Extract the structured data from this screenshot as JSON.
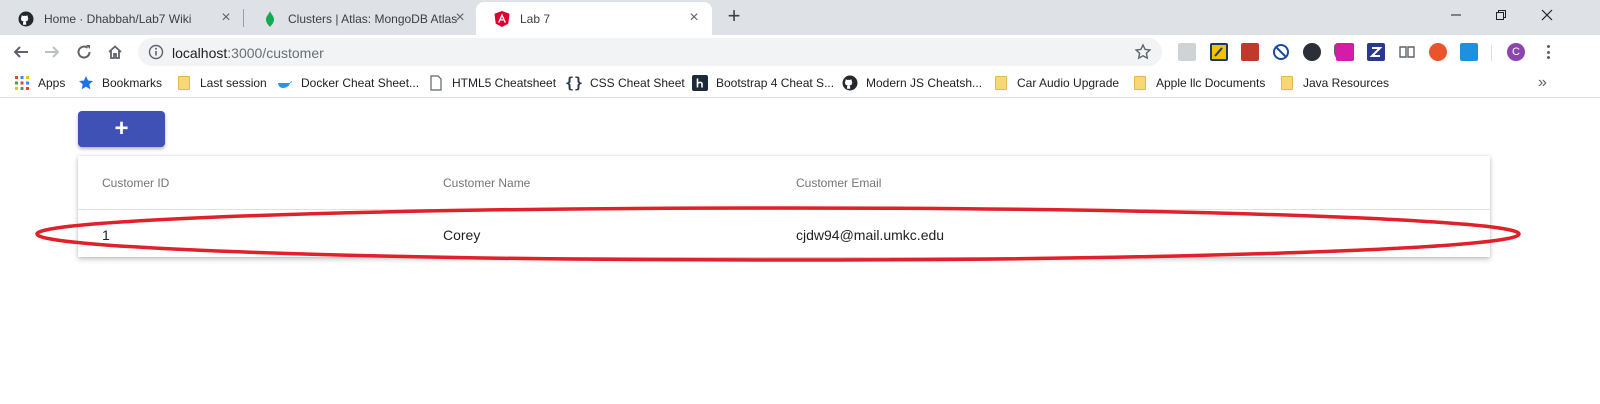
{
  "browser": {
    "tabs": [
      {
        "title": "Home · Dhabbah/Lab7 Wiki",
        "icon": "github-icon"
      },
      {
        "title": "Clusters | Atlas: MongoDB Atlas",
        "icon": "mongodb-leaf-icon"
      },
      {
        "title": "Lab 7",
        "icon": "angular-icon",
        "active": true
      }
    ],
    "url_host": "localhost",
    "url_path": ":3000/customer",
    "profile_initial": "C",
    "bookmarks": [
      {
        "label": "Apps",
        "icon": "apps-grid-icon"
      },
      {
        "label": "Bookmarks",
        "icon": "star-icon"
      },
      {
        "label": "Last session",
        "icon": "folder-icon"
      },
      {
        "label": "Docker Cheat Sheet...",
        "icon": "docker-icon"
      },
      {
        "label": "HTML5 Cheatsheet",
        "icon": "page-icon"
      },
      {
        "label": "CSS Cheat Sheet",
        "icon": "braces-icon"
      },
      {
        "label": "Bootstrap 4 Cheat S...",
        "icon": "h-logo-icon"
      },
      {
        "label": "Modern JS Cheatsh...",
        "icon": "github-icon"
      },
      {
        "label": "Car Audio Upgrade",
        "icon": "folder-icon"
      },
      {
        "label": "Apple llc Documents",
        "icon": "folder-icon"
      },
      {
        "label": "Java Resources",
        "icon": "folder-icon"
      }
    ]
  },
  "page": {
    "add_button_label": "+",
    "table": {
      "headers": [
        "Customer ID",
        "Customer Name",
        "Customer Email"
      ],
      "rows": [
        [
          "1",
          "Corey",
          "cjdw94@mail.umkc.edu"
        ]
      ]
    }
  },
  "colors": {
    "primary": "#3f51b5",
    "highlight": "#e0202a"
  }
}
